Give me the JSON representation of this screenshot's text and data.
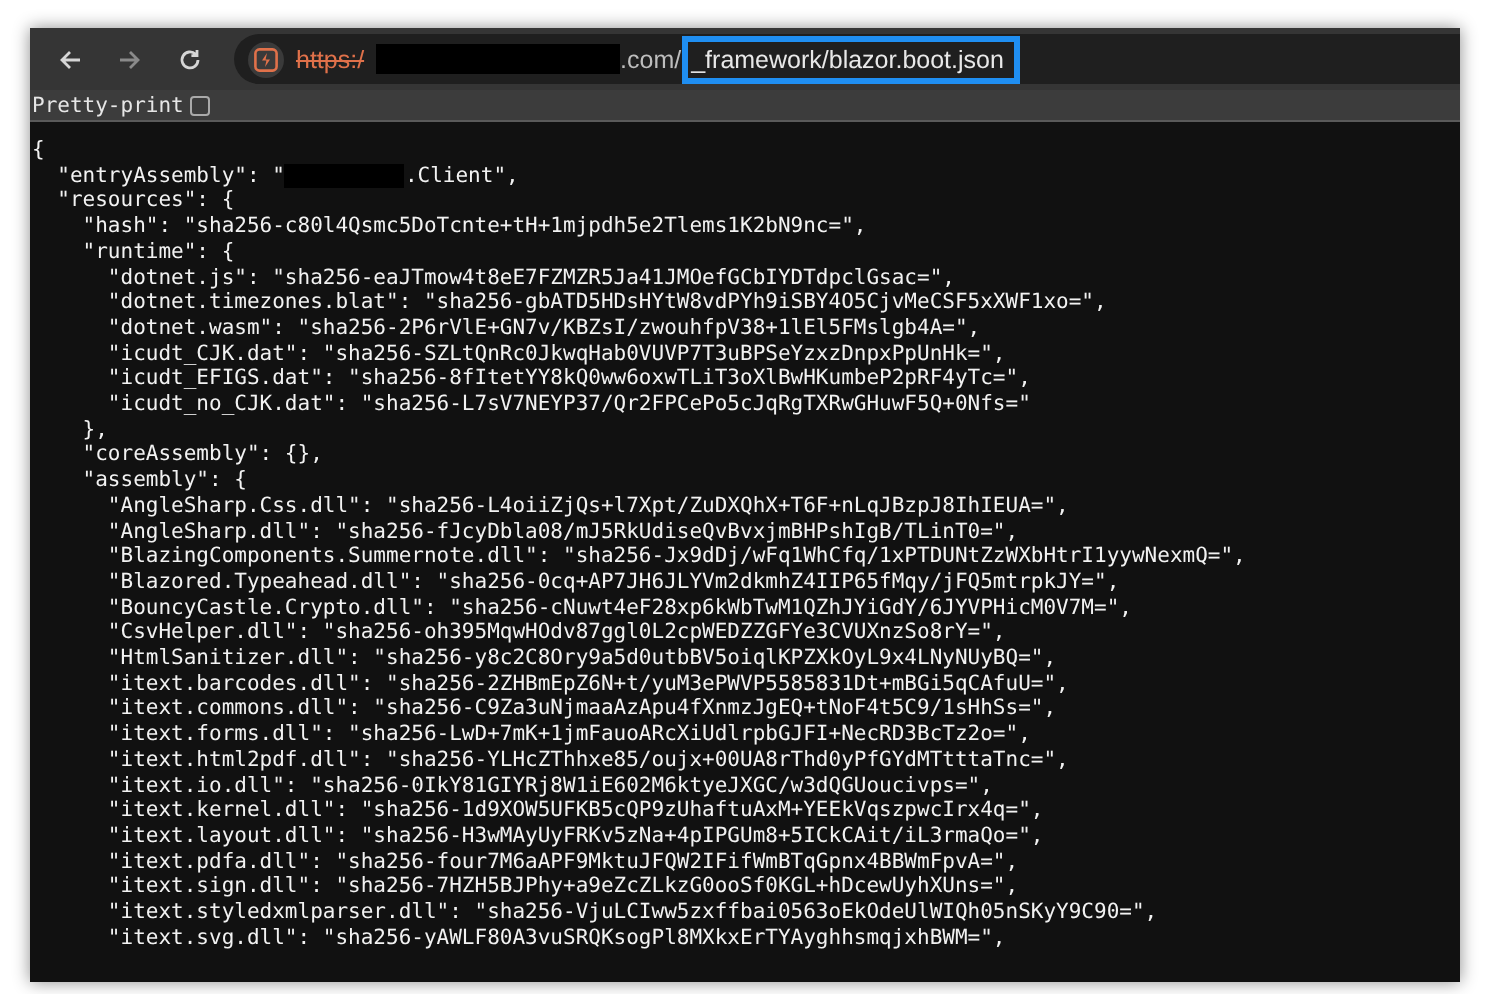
{
  "address_bar": {
    "scheme": "https:/",
    "host_tail": ".com/",
    "path": "_framework/blazor.boot.json",
    "path_highlighted": true
  },
  "pretty_print": {
    "label": "Pretty-print",
    "checked": false
  },
  "code_lines": [
    {
      "kind": "text",
      "text": "{"
    },
    {
      "kind": "redacted",
      "before": "  \"entryAssembly\": \"",
      "after": ".Client\","
    },
    {
      "kind": "text",
      "text": "  \"resources\": {"
    },
    {
      "kind": "text",
      "text": "    \"hash\": \"sha256-c80l4Qsmc5DoTcnte+tH+1mjpdh5e2Tlems1K2bN9nc=\","
    },
    {
      "kind": "text",
      "text": "    \"runtime\": {"
    },
    {
      "kind": "text",
      "text": "      \"dotnet.js\": \"sha256-eaJTmow4t8eE7FZMZR5Ja41JMOefGCbIYDTdpclGsac=\","
    },
    {
      "kind": "text",
      "text": "      \"dotnet.timezones.blat\": \"sha256-gbATD5HDsHYtW8vdPYh9iSBY4O5CjvMeCSF5xXWF1xo=\","
    },
    {
      "kind": "text",
      "text": "      \"dotnet.wasm\": \"sha256-2P6rVlE+GN7v/KBZsI/zwouhfpV38+1lEl5FMslgb4A=\","
    },
    {
      "kind": "text",
      "text": "      \"icudt_CJK.dat\": \"sha256-SZLtQnRc0JkwqHab0VUVP7T3uBPSeYzxzDnpxPpUnHk=\","
    },
    {
      "kind": "text",
      "text": "      \"icudt_EFIGS.dat\": \"sha256-8fItetYY8kQ0ww6oxwTLiT3oXlBwHKumbeP2pRF4yTc=\","
    },
    {
      "kind": "text",
      "text": "      \"icudt_no_CJK.dat\": \"sha256-L7sV7NEYP37/Qr2FPCePo5cJqRgTXRwGHuwF5Q+0Nfs=\""
    },
    {
      "kind": "text",
      "text": "    },"
    },
    {
      "kind": "text",
      "text": "    \"coreAssembly\": {},"
    },
    {
      "kind": "text",
      "text": "    \"assembly\": {"
    },
    {
      "kind": "text",
      "text": "      \"AngleSharp.Css.dll\": \"sha256-L4oiiZjQs+l7Xpt/ZuDXQhX+T6F+nLqJBzpJ8IhIEUA=\","
    },
    {
      "kind": "text",
      "text": "      \"AngleSharp.dll\": \"sha256-fJcyDbla08/mJ5RkUdiseQvBvxjmBHPshIgB/TLinT0=\","
    },
    {
      "kind": "text",
      "text": "      \"BlazingComponents.Summernote.dll\": \"sha256-Jx9dDj/wFq1WhCfq/1xPTDUNtZzWXbHtrI1yywNexmQ=\","
    },
    {
      "kind": "text",
      "text": "      \"Blazored.Typeahead.dll\": \"sha256-0cq+AP7JH6JLYVm2dkmhZ4IIP65fMqy/jFQ5mtrpkJY=\","
    },
    {
      "kind": "text",
      "text": "      \"BouncyCastle.Crypto.dll\": \"sha256-cNuwt4eF28xp6kWbTwM1QZhJYiGdY/6JYVPHicM0V7M=\","
    },
    {
      "kind": "text",
      "text": "      \"CsvHelper.dll\": \"sha256-oh395MqwHOdv87ggl0L2cpWEDZZGFYe3CVUXnzSo8rY=\","
    },
    {
      "kind": "text",
      "text": "      \"HtmlSanitizer.dll\": \"sha256-y8c2C8Ory9a5d0utbBV5oiqlKPZXkOyL9x4LNyNUyBQ=\","
    },
    {
      "kind": "text",
      "text": "      \"itext.barcodes.dll\": \"sha256-2ZHBmEpZ6N+t/yuM3ePWVP5585831Dt+mBGi5qCAfuU=\","
    },
    {
      "kind": "text",
      "text": "      \"itext.commons.dll\": \"sha256-C9Za3uNjmaaAzApu4fXnmzJgEQ+tNoF4t5C9/1sHhSs=\","
    },
    {
      "kind": "text",
      "text": "      \"itext.forms.dll\": \"sha256-LwD+7mK+1jmFauoARcXiUdlrpbGJFI+NecRD3BcTz2o=\","
    },
    {
      "kind": "text",
      "text": "      \"itext.html2pdf.dll\": \"sha256-YLHcZThhxe85/oujx+00UA8rThd0yPfGYdMTtttaTnc=\","
    },
    {
      "kind": "text",
      "text": "      \"itext.io.dll\": \"sha256-0IkY81GIYRj8W1iE602M6ktyeJXGC/w3dQGUoucivps=\","
    },
    {
      "kind": "text",
      "text": "      \"itext.kernel.dll\": \"sha256-1d9XOW5UFKB5cQP9zUhaftuAxM+YEEkVqszpwcIrx4q=\","
    },
    {
      "kind": "text",
      "text": "      \"itext.layout.dll\": \"sha256-H3wMAyUyFRKv5zNa+4pIPGUm8+5ICkCAit/iL3rmaQo=\","
    },
    {
      "kind": "text",
      "text": "      \"itext.pdfa.dll\": \"sha256-four7M6aAPF9MktuJFQW2IFifWmBTqGpnx4BBWmFpvA=\","
    },
    {
      "kind": "text",
      "text": "      \"itext.sign.dll\": \"sha256-7HZH5BJPhy+a9eZcZLkzG0ooSf0KGL+hDcewUyhXUns=\","
    },
    {
      "kind": "text",
      "text": "      \"itext.styledxmlparser.dll\": \"sha256-VjuLCIww5zxffbai0563oEkOdeUlWIQh05nSKyY9C90=\","
    },
    {
      "kind": "text",
      "text": "      \"itext.svg.dll\": \"sha256-yAWLF80A3vuSRQKsogPl8MXkxErTYAyghhsmqjxhBWM=\","
    }
  ]
}
